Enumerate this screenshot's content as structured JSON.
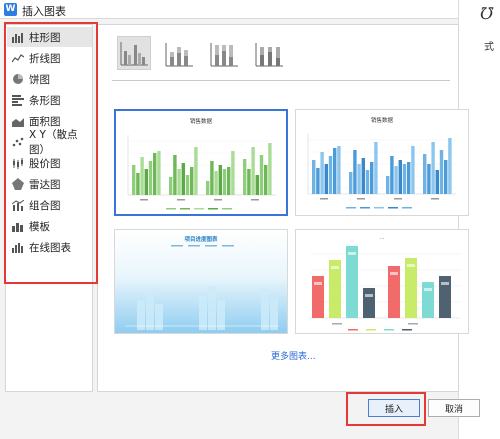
{
  "window": {
    "title": "插入图表"
  },
  "background_app": {
    "glyph": "℧",
    "text": "式"
  },
  "sidebar": {
    "items": [
      {
        "label": "柱形图",
        "icon": "bar-chart-icon"
      },
      {
        "label": "折线图",
        "icon": "line-chart-icon"
      },
      {
        "label": "饼图",
        "icon": "pie-chart-icon"
      },
      {
        "label": "条形图",
        "icon": "horizontal-bar-chart-icon"
      },
      {
        "label": "面积图",
        "icon": "area-chart-icon"
      },
      {
        "label": "X Y（散点图）",
        "icon": "scatter-chart-icon"
      },
      {
        "label": "股价图",
        "icon": "stock-chart-icon"
      },
      {
        "label": "雷达图",
        "icon": "radar-chart-icon"
      },
      {
        "label": "组合图",
        "icon": "combo-chart-icon"
      },
      {
        "label": "模板",
        "icon": "template-icon"
      },
      {
        "label": "在线图表",
        "icon": "online-chart-icon"
      }
    ],
    "selected_index": 0
  },
  "subtypes": [
    {
      "name": "clustered-column",
      "selected": true
    },
    {
      "name": "stacked-column",
      "selected": false
    },
    {
      "name": "percent-stacked-column",
      "selected": false
    },
    {
      "name": "3d-column",
      "selected": false
    }
  ],
  "previews": [
    {
      "title": "销售数据",
      "style": "green-bars",
      "selected": true,
      "colors": [
        "#8fce7a",
        "#6fb85a",
        "#a9dc94",
        "#5da94a"
      ],
      "groups": 4,
      "x_labels": [
        "..",
        "..",
        "..",
        ".."
      ]
    },
    {
      "title": "销售数据",
      "style": "blue-bars",
      "selected": false,
      "colors": [
        "#6fb3e6",
        "#4a9bd8",
        "#8cc6ef",
        "#3a88c9"
      ],
      "groups": 4,
      "x_labels": [
        "..",
        "..",
        "..",
        ".."
      ]
    },
    {
      "title": "项目进度图表",
      "style": "ocean",
      "selected": false,
      "colors": [
        "#9fd6f2",
        "#cdebf9",
        "#ffffff"
      ],
      "groups": 3
    },
    {
      "title": "... ",
      "style": "colorful",
      "selected": false,
      "colors": [
        "#f26b6b",
        "#c8ec6a",
        "#7ddbd4",
        "#4e6272"
      ],
      "data_labels": [
        "...",
        "...",
        "..."
      ]
    }
  ],
  "more_link": "更多图表...",
  "buttons": {
    "ok": "插入",
    "cancel": "取消"
  },
  "accent_color": "#3a74d9",
  "highlight_color": "#e53935"
}
